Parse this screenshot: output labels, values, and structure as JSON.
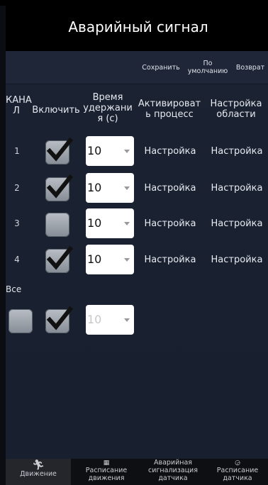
{
  "title": "Аварийный сигнал",
  "toolbar": {
    "save": "Сохранить",
    "default_line1": "По",
    "default_line2": "умолчанию",
    "back": "Возврат"
  },
  "headers": {
    "channel_l1": "КАНА",
    "channel_l2": "Л",
    "enable": "Включить",
    "hold_l1": "Время",
    "hold_l2": "удержани",
    "hold_l3": "я (с)",
    "activate_l1": "Активироват",
    "activate_l2": "ь процесс",
    "area_l1": "Настройка",
    "area_l2": "области"
  },
  "rows": [
    {
      "num": "1",
      "checked": true,
      "hold": "10",
      "activate": "Настройка",
      "area": "Настройка"
    },
    {
      "num": "2",
      "checked": true,
      "hold": "10",
      "activate": "Настройка",
      "area": "Настройка"
    },
    {
      "num": "3",
      "checked": false,
      "hold": "10",
      "activate": "Настройка",
      "area": "Настройка"
    },
    {
      "num": "4",
      "checked": true,
      "hold": "10",
      "activate": "Настройка",
      "area": "Настройка"
    }
  ],
  "all": {
    "label": "Все",
    "select_checked": false,
    "enable_checked": true,
    "hold": "10"
  },
  "nav": {
    "motion": "Движение",
    "motion_schedule_l1": "Расписание",
    "motion_schedule_l2": "движения",
    "sensor_alarm_l1": "Аварийная",
    "sensor_alarm_l2": "сигнализация",
    "sensor_alarm_l3": "датчика",
    "sensor_schedule_l1": "Расписание",
    "sensor_schedule_l2": "датчика"
  },
  "colors": {
    "background": "#0b0d12",
    "panel": "#1b2232",
    "checkbox": "#a4a9b1",
    "checkmark": "#111111"
  },
  "icons": {
    "motion": "running-person-icon",
    "motion_schedule": "calendar-icon",
    "sensor_alarm": "alarm-icon",
    "sensor_schedule": "sensor-calendar-icon"
  }
}
